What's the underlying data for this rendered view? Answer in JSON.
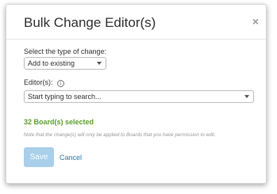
{
  "dialog": {
    "title": "Bulk Change Editor(s)",
    "close_symbol": "×",
    "change_type": {
      "label": "Select the type of change:",
      "selected_value": "Add to existing"
    },
    "editors": {
      "label": "Editor(s):",
      "info_symbol": "i",
      "placeholder": "Start typing to search..."
    },
    "selected_count_text": "32 Board(s) selected",
    "note": "Note that the change(s) will only be applied to Boards that you have permission to edit.",
    "actions": {
      "save_label": "Save",
      "cancel_label": "Cancel"
    }
  },
  "colors": {
    "success_green": "#5aa02c",
    "link_blue": "#2a7ab8",
    "save_button_disabled": "#a9cfea"
  },
  "icons": {
    "close": "close-icon",
    "info": "info-icon",
    "dropdown": "chevron-down-icon"
  }
}
